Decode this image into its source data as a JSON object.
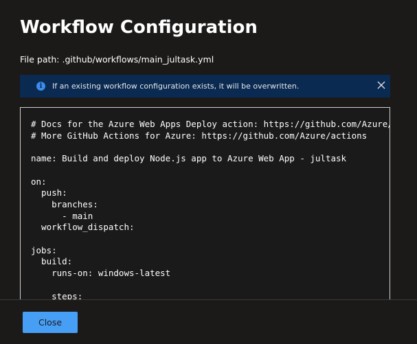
{
  "dialog": {
    "title": "Workflow Configuration",
    "file_path": "File path: .github/workflows/main_jultask.yml"
  },
  "banner": {
    "message": "If an existing workflow configuration exists, it will be overwritten.",
    "icon": "info-icon",
    "dismiss_icon": "close-icon",
    "color": "#0a2a52"
  },
  "code": {
    "content": "# Docs for the Azure Web Apps Deploy action: https://github.com/Azure/webapps-deploy\n# More GitHub Actions for Azure: https://github.com/Azure/actions\n\nname: Build and deploy Node.js app to Azure Web App - jultask\n\non:\n  push:\n    branches:\n      - main\n  workflow_dispatch:\n\njobs:\n  build:\n    runs-on: windows-latest\n\n    steps:"
  },
  "footer": {
    "close_label": "Close",
    "accent": "#479ef5"
  }
}
